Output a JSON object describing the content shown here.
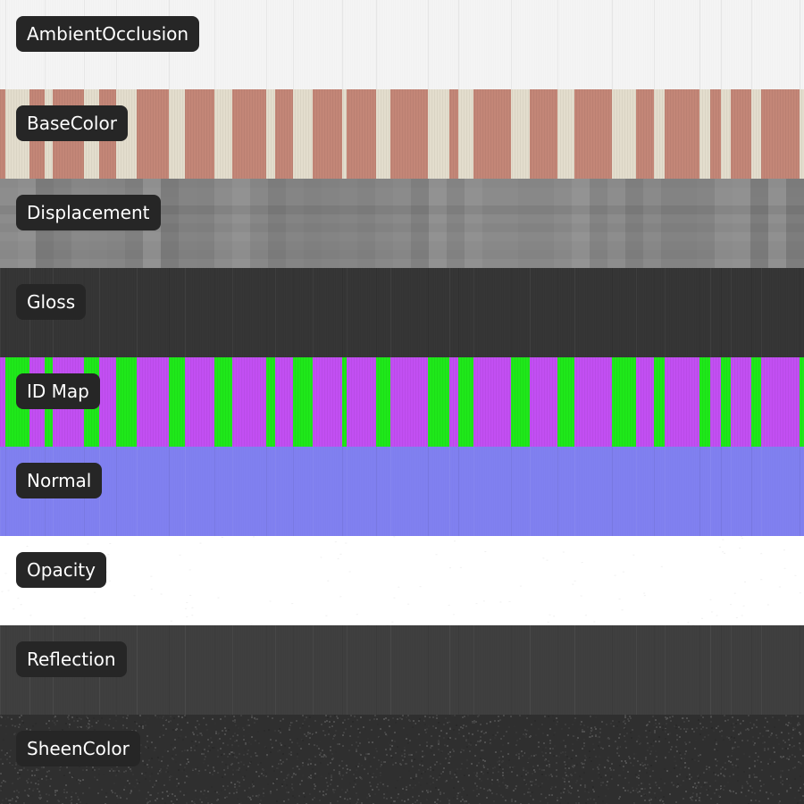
{
  "channels": [
    {
      "label": "AmbientOcclusion",
      "texture": "ambient-occlusion",
      "base": "#f5f5f5",
      "accent": "#e9e9e9"
    },
    {
      "label": "BaseColor",
      "texture": "base-color",
      "base": "#c38677",
      "accent": "#e3ddcd"
    },
    {
      "label": "Displacement",
      "texture": "displacement",
      "base": "#727272",
      "accent": "#8a8a8a"
    },
    {
      "label": "Gloss",
      "texture": "gloss",
      "base": "#343434",
      "accent": "#3d3d3d"
    },
    {
      "label": "ID Map",
      "texture": "id-map",
      "base": "#c24ff2",
      "accent": "#1fe81a"
    },
    {
      "label": "Normal",
      "texture": "normal",
      "base": "#8080f0",
      "accent": "#7c7ce8"
    },
    {
      "label": "Opacity",
      "texture": "opacity",
      "base": "#ffffff",
      "accent": "#f8f8f8"
    },
    {
      "label": "Reflection",
      "texture": "reflection",
      "base": "#3e3e3e",
      "accent": "#444444"
    },
    {
      "label": "SheenColor",
      "texture": "sheen-color",
      "base": "#2f2f2f",
      "accent": "#4a4a4a"
    }
  ]
}
